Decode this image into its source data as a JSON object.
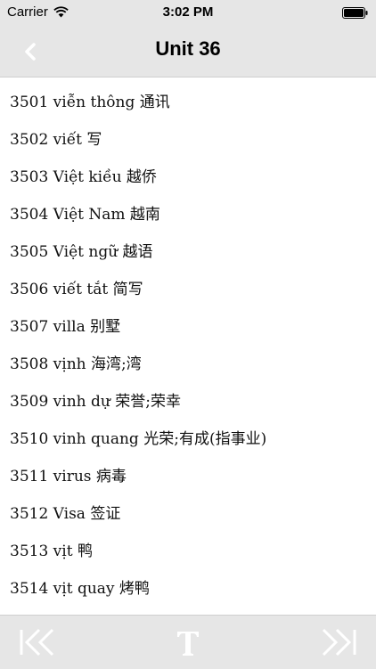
{
  "status_bar": {
    "carrier": "Carrier",
    "time": "3:02 PM",
    "wifi_icon": "wifi-icon",
    "battery_icon": "battery-full-icon"
  },
  "nav": {
    "title": "Unit 36",
    "back_icon": "chevron-left-icon"
  },
  "words": [
    {
      "text": "3501 viễn thông 通讯"
    },
    {
      "text": "3502 viết 写"
    },
    {
      "text": "3503 Việt kiều 越侨"
    },
    {
      "text": "3504 Việt Nam 越南"
    },
    {
      "text": "3505 Việt ngữ 越语"
    },
    {
      "text": "3506 viết tắt 简写"
    },
    {
      "text": "3507 villa 别墅"
    },
    {
      "text": "3508 vịnh 海湾;湾"
    },
    {
      "text": "3509 vinh dự 荣誉;荣幸"
    },
    {
      "text": "3510 vinh quang 光荣;有成(指事业)"
    },
    {
      "text": "3511 virus 病毒"
    },
    {
      "text": "3512 Visa 签证"
    },
    {
      "text": "3513 vịt 鸭"
    },
    {
      "text": "3514 vịt quay 烤鸭"
    }
  ],
  "toolbar": {
    "first_icon": "skip-to-first-icon",
    "font_icon": "text-format-icon",
    "last_icon": "skip-to-last-icon"
  },
  "colors": {
    "bar_background": "#e6e6e6",
    "icon_white": "#ffffff",
    "text": "#111111"
  }
}
